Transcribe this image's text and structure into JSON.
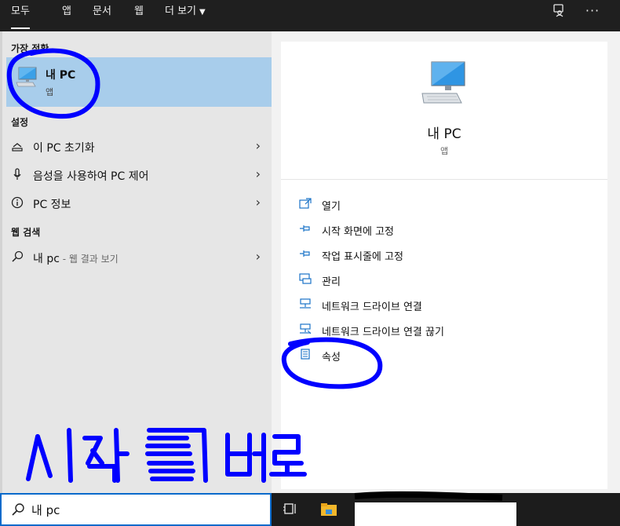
{
  "topbar": {
    "tabs": [
      "모두",
      "앱",
      "문서",
      "웹"
    ],
    "more_label": "더 보기",
    "feedback_icon": "feedback-icon",
    "more_options_icon": "more-options-icon"
  },
  "left": {
    "best_match_header": "가장 정확",
    "best_match": {
      "title": "내 PC",
      "subtitle": "앱"
    },
    "settings_header": "설정",
    "settings_items": [
      {
        "icon": "reset-icon",
        "label": "이 PC 초기화"
      },
      {
        "icon": "microphone-icon",
        "label": "음성을 사용하여 PC 제어"
      },
      {
        "icon": "info-icon",
        "label": "PC 정보"
      }
    ],
    "web_header": "웹 검색",
    "web_item": {
      "label": "내 pc",
      "suffix": " - 웹 결과 보기"
    }
  },
  "right": {
    "app_name": "내 PC",
    "app_kind": "앱",
    "actions": [
      {
        "icon": "open-icon",
        "label": "열기"
      },
      {
        "icon": "pin-start-icon",
        "label": "시작 화면에 고정"
      },
      {
        "icon": "pin-taskbar-icon",
        "label": "작업 표시줄에 고정"
      },
      {
        "icon": "manage-icon",
        "label": "관리"
      },
      {
        "icon": "map-drive-icon",
        "label": "네트워크 드라이브 연결"
      },
      {
        "icon": "disconnect-drive-icon",
        "label": "네트워크 드라이브 연결 끊기"
      },
      {
        "icon": "properties-icon",
        "label": "속성"
      }
    ]
  },
  "search": {
    "value": "내 pc"
  },
  "annotation": {
    "handwritten_text": "시작 버튼",
    "color": "#0000ff"
  },
  "colors": {
    "accent": "#0a6acb",
    "selection": "#a8cdeb"
  }
}
